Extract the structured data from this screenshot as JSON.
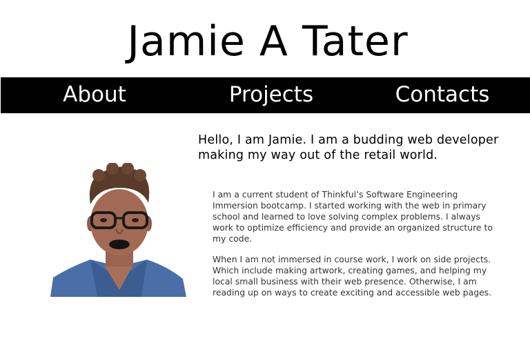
{
  "header": {
    "title": "Jamie A Tater"
  },
  "nav": {
    "about": "About",
    "projects": "Projects",
    "contacts": "Contacts"
  },
  "main": {
    "intro": "Hello, I am Jamie. I am a budding web developer making my way out of the retail world.",
    "bio": [
      "I am a current student of Thinkful’s Software Engineering Immersion bootcamp. I started working with the web in primary school and learned to love solving complex problems. I always work to optimize efficiency and provide an organized structure to my code.",
      "When I am not immersed in course work, I work on side projects. Which include making artwork, creating games, and helping my local small business with their web presence. Otherwise, I am reading up on ways to create exciting and accessible web pages."
    ]
  }
}
